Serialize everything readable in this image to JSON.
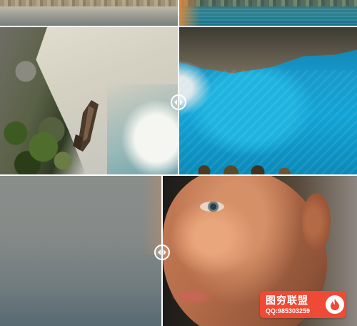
{
  "watermark": {
    "title": "图穷联盟",
    "contact": "QQ:985303259",
    "brand_color": "#ee4a36",
    "icon": "flame-icon"
  },
  "handles": {
    "icon": "left-right-arrows-icon",
    "color": "#ffffff"
  },
  "panels": [
    {
      "name": "lake-comparison",
      "icon": "left-right-arrows-icon"
    },
    {
      "name": "shipwreck-beach-comparison",
      "icon": "left-right-arrows-icon"
    },
    {
      "name": "portrait-comparison",
      "icon": "left-right-arrows-icon"
    }
  ]
}
